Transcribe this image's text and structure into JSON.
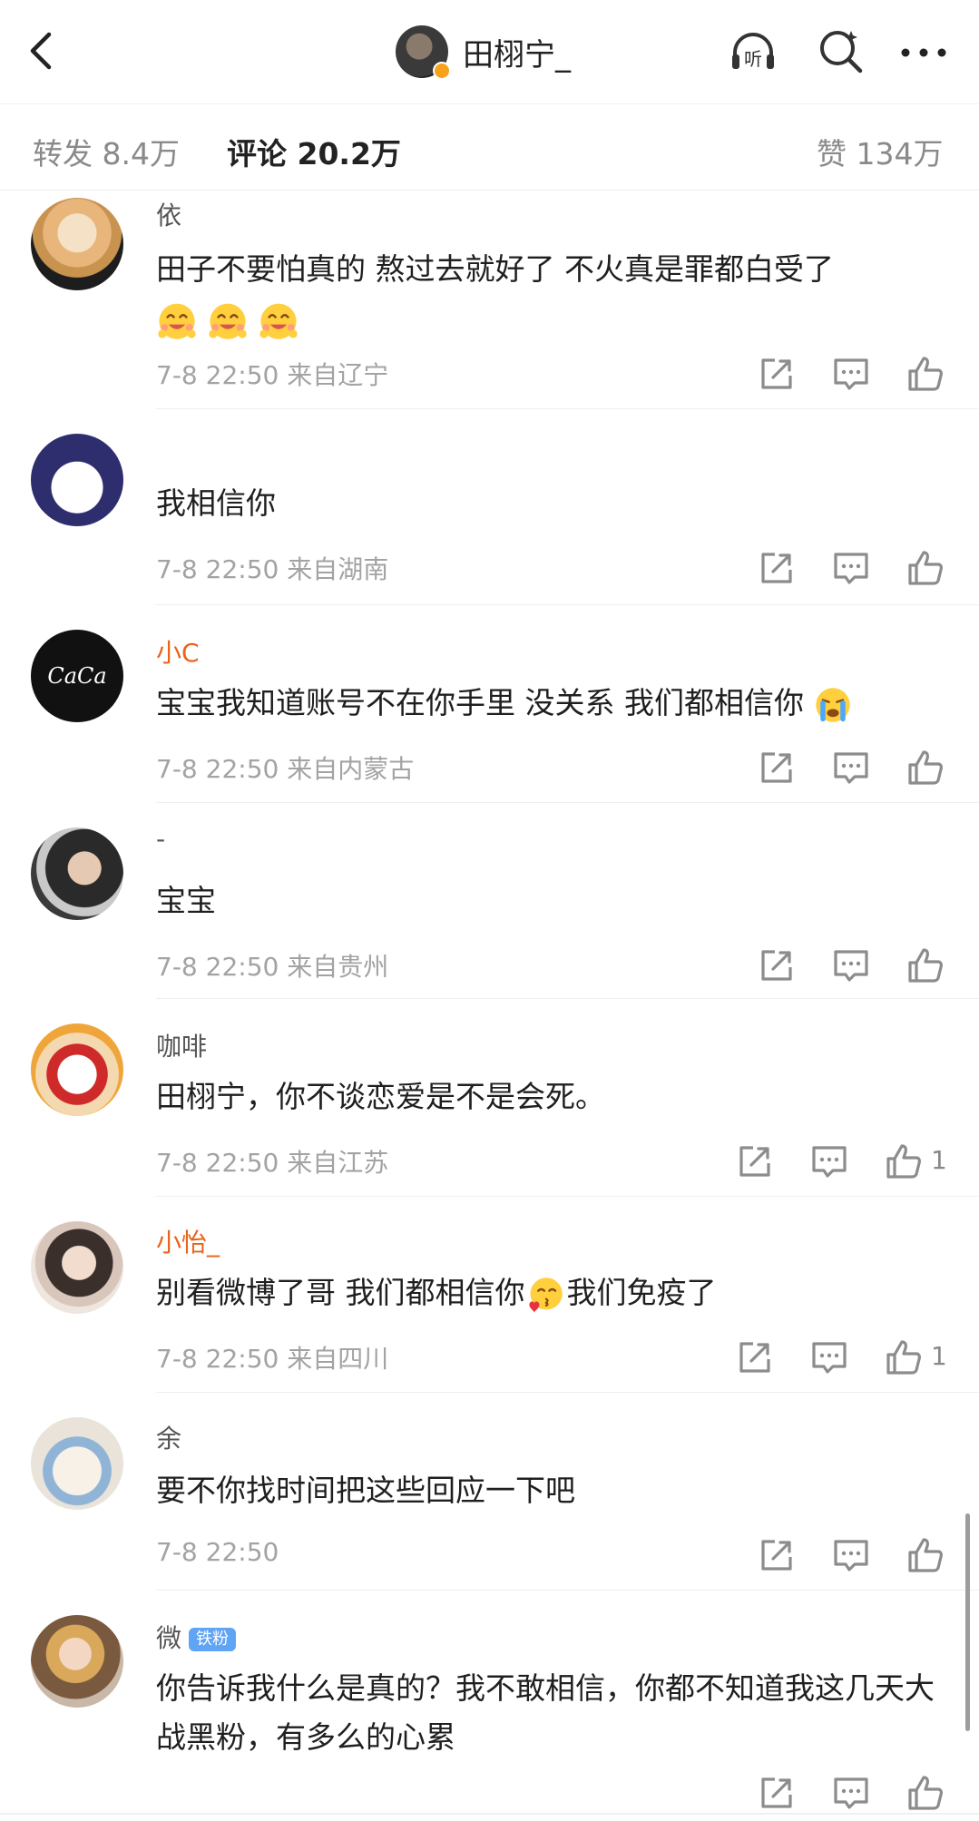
{
  "header": {
    "title": "田栩宁_",
    "listen_label": "听"
  },
  "tabs": {
    "forward": "转发 8.4万",
    "comments": "评论 20.2万",
    "likes": "赞 134万"
  },
  "comments": [
    {
      "name": "依",
      "text": "田子不要怕真的 熬过去就好了 不火真是罪都白受了",
      "emoji_count": 3,
      "time": "7-8 22:50",
      "location": "来自辽宁",
      "likes": ""
    },
    {
      "name": "",
      "text": "我相信你",
      "time": "7-8 22:50",
      "location": "来自湖南",
      "likes": ""
    },
    {
      "name": "小C",
      "text": "宝宝我知道账号不在你手里 没关系 我们都相信你",
      "time": "7-8 22:50",
      "location": "来自内蒙古",
      "likes": ""
    },
    {
      "name": "-",
      "text": "宝宝",
      "time": "7-8 22:50",
      "location": "来自贵州",
      "likes": ""
    },
    {
      "name": "咖啡",
      "text": "田栩宁，你不谈恋爱是不是会死。",
      "time": "7-8 22:50",
      "location": "来自江苏",
      "likes": "1"
    },
    {
      "name": "小怡_",
      "text_before": "别看微博了哥 我们都相信你",
      "text_after": "我们免疫了",
      "time": "7-8 22:50",
      "location": "来自四川",
      "likes": "1"
    },
    {
      "name": "余",
      "text": "要不你找时间把这些回应一下吧",
      "time": "7-8 22:50",
      "location": "",
      "likes": ""
    },
    {
      "name": "微",
      "badge": "铁粉",
      "text": "你告诉我什么是真的？我不敢相信，你都不知道我这几天大战黑粉，有多么的心累",
      "time": "",
      "location": "",
      "likes": ""
    }
  ],
  "colors": {
    "accent_name": "#e8641b",
    "text_primary": "#1f1f1f",
    "text_meta": "#a3a3a3",
    "fan_badge": "#5fa4f5",
    "verify_badge": "#f7a21b"
  },
  "icons": [
    "back-icon",
    "listen-icon",
    "search-icon",
    "more-icon",
    "share-icon",
    "reply-icon",
    "like-icon"
  ]
}
